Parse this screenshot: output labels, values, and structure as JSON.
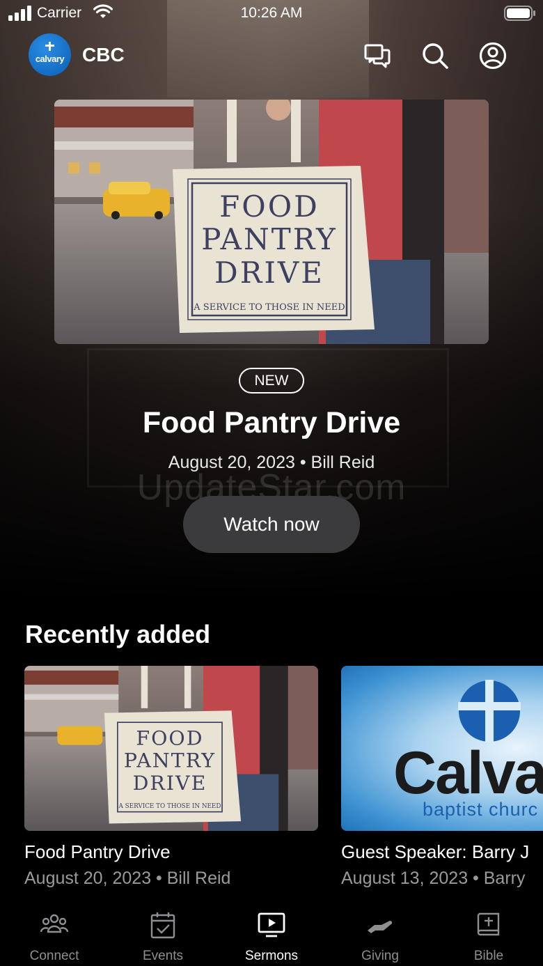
{
  "status_bar": {
    "carrier": "Carrier",
    "time": "10:26 AM"
  },
  "header": {
    "logo_text": "calvary",
    "app_name": "CBC"
  },
  "hero": {
    "badge": "NEW",
    "title": "Food Pantry Drive",
    "meta": "August 20, 2023 • Bill Reid",
    "watch_label": "Watch now",
    "image": {
      "line1": "FOOD",
      "line2": "PANTRY",
      "line3": "DRIVE",
      "tagline": "A SERVICE TO THOSE IN NEED"
    }
  },
  "watermark": "UpdateStar.com",
  "recent": {
    "title": "Recently added",
    "items": [
      {
        "title": "Food Pantry Drive",
        "meta": "August 20, 2023 • Bill Reid"
      },
      {
        "title": "Guest Speaker: Barry J",
        "meta": "August 13, 2023 • Barry",
        "logo_word": "Calvar",
        "logo_sub": "baptist churc"
      }
    ]
  },
  "tabs": [
    {
      "label": "Connect",
      "icon": "people-icon",
      "active": false
    },
    {
      "label": "Events",
      "icon": "calendar-check-icon",
      "active": false
    },
    {
      "label": "Sermons",
      "icon": "tv-play-icon",
      "active": true
    },
    {
      "label": "Giving",
      "icon": "giving-hand-icon",
      "active": false
    },
    {
      "label": "Bible",
      "icon": "bible-icon",
      "active": false
    }
  ],
  "colors": {
    "background": "#000000",
    "button": "#3b3b3d",
    "muted": "#9a9a9e",
    "logo_blue": "#0a5fb5"
  }
}
